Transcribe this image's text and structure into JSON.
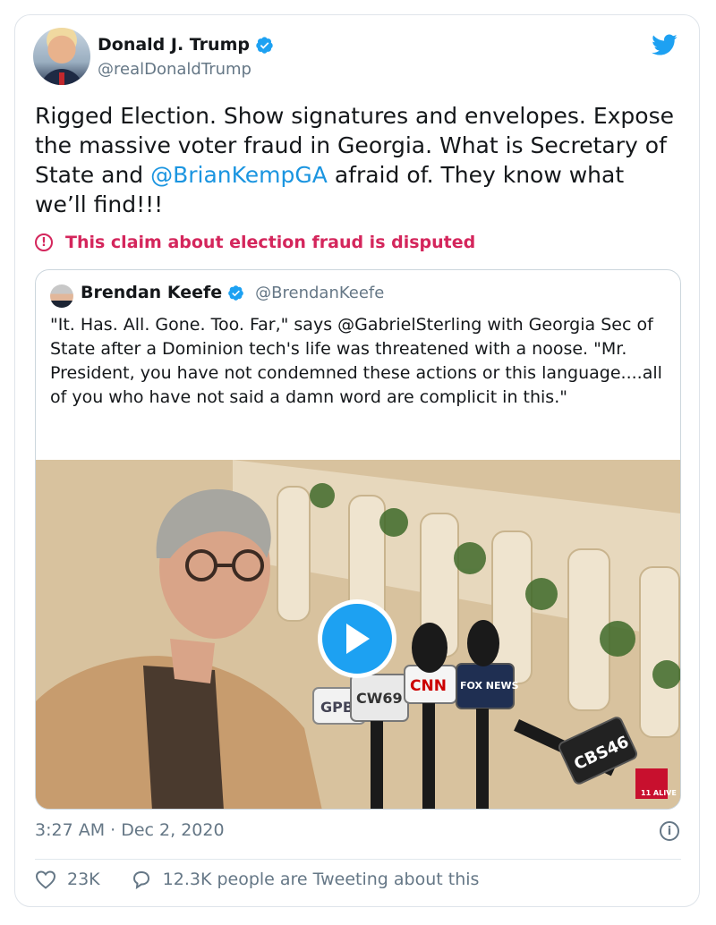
{
  "tweet": {
    "author_name": "Donald J. Trump",
    "author_handle": "@realDonaldTrump",
    "text_part1": "Rigged Election. Show signatures and envelopes. Expose the massive voter fraud in Georgia. What is Secretary of State and ",
    "text_mention": "@BrianKempGA",
    "text_part2": " afraid of. They know what we’ll find!!!",
    "dispute_label": "This claim about election fraud is disputed",
    "timestamp": "3:27 AM · Dec 2, 2020",
    "likes": "23K",
    "conversation": "12.3K people are Tweeting about this"
  },
  "quoted": {
    "author_name": "Brendan Keefe",
    "author_handle": "@BrendanKeefe",
    "text": "\"It. Has. All. Gone. Too. Far,\" says @GabrielSterling with Georgia Sec of State after a Dominion tech's life was threatened with a noose. \"Mr. President, you have not condemned these actions or this language....all of you who have not said a damn word are complicit in this.\""
  },
  "media_overlay": {
    "mic_labels": [
      "GPB",
      "CW69",
      "CNN",
      "FOX NEWS",
      "CBS46",
      "11 ALIVE"
    ]
  },
  "icons": [
    "verified-badge-icon",
    "twitter-bird-icon",
    "dispute-alert-icon",
    "play-icon",
    "info-icon",
    "heart-icon",
    "reply-bubble-icon"
  ],
  "colors": {
    "accent": "#1da1f2",
    "mention": "#1b95e0",
    "dispute": "#d4265c",
    "secondary_text": "#657786"
  }
}
